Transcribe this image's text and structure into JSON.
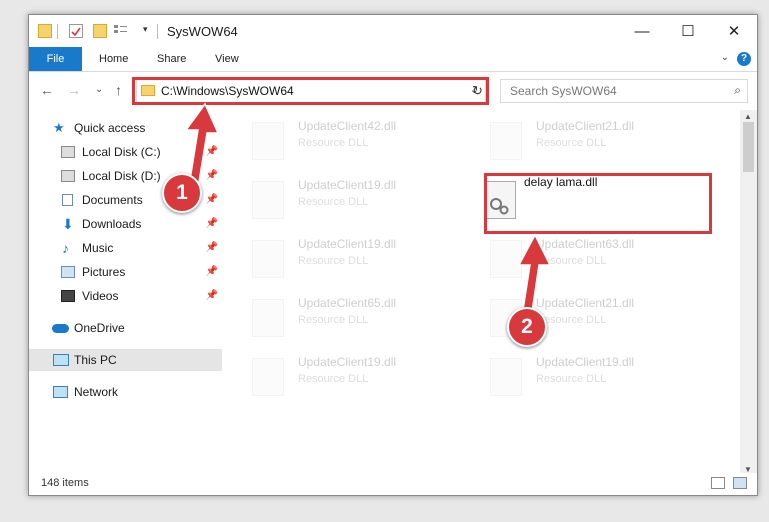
{
  "window": {
    "title": "SysWOW64",
    "minimize": "—",
    "maximize": "☐",
    "close": "✕"
  },
  "ribbon": {
    "tabs": [
      "File",
      "Home",
      "Share",
      "View"
    ],
    "help": "?",
    "collapse": "⌄"
  },
  "nav": {
    "back": "←",
    "forward": "→",
    "recent": "⌄",
    "up": "↑",
    "refresh": "↻"
  },
  "address": {
    "path": "C:\\Windows\\SysWOW64",
    "dropdown": "⌄"
  },
  "search": {
    "placeholder": "Search SysWOW64",
    "icon": "⌕"
  },
  "sidebar": {
    "items": [
      {
        "label": "Quick access",
        "icon": "star-icon"
      },
      {
        "label": "Local Disk (C:)",
        "icon": "drive-icon",
        "pinned": true
      },
      {
        "label": "Local Disk (D:)",
        "icon": "drive-icon",
        "pinned": true
      },
      {
        "label": "Documents",
        "icon": "documents-icon",
        "pinned": true
      },
      {
        "label": "Downloads",
        "icon": "downloads-icon",
        "pinned": true
      },
      {
        "label": "Music",
        "icon": "music-icon",
        "pinned": true
      },
      {
        "label": "Pictures",
        "icon": "pictures-icon",
        "pinned": true
      },
      {
        "label": "Videos",
        "icon": "videos-icon",
        "pinned": true
      },
      {
        "label": "OneDrive",
        "icon": "onedrive-icon"
      },
      {
        "label": "This PC",
        "icon": "pc-icon",
        "selected": true
      },
      {
        "label": "Network",
        "icon": "network-icon"
      }
    ],
    "pin_glyph": "📌"
  },
  "files": [
    {
      "name": "UpdateClient42.dll",
      "desc": "Resource DLL"
    },
    {
      "name": "UpdateClient21.dll",
      "desc": "Resource DLL"
    },
    {
      "name": "UpdateClient19.dll",
      "desc": "Resource DLL"
    },
    {
      "name": "delay lama.dll",
      "desc": ""
    },
    {
      "name": "UpdateClient19.dll",
      "desc": "Resource DLL"
    },
    {
      "name": "UpdateClient63.dll",
      "desc": "Resource DLL"
    },
    {
      "name": "UpdateClient65.dll",
      "desc": "Resource DLL"
    },
    {
      "name": "UpdateClient21.dll",
      "desc": "Resource DLL"
    },
    {
      "name": "UpdateClient19.dll",
      "desc": "Resource DLL"
    },
    {
      "name": "UpdateClient19.dll",
      "desc": "Resource DLL"
    }
  ],
  "status": {
    "items": "148 items"
  },
  "annotations": {
    "badge1": "1",
    "badge2": "2",
    "color": "#d7393d"
  }
}
